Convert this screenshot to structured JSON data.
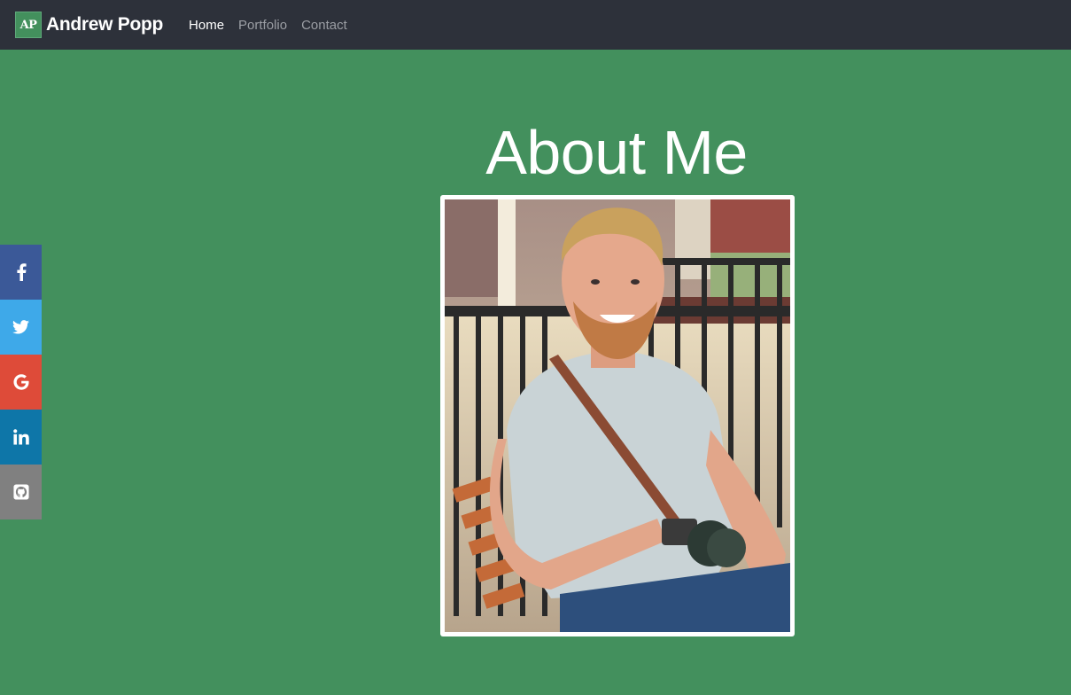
{
  "navbar": {
    "logo_text": "AP",
    "brand_name": "Andrew Popp",
    "links": [
      {
        "label": "Home",
        "active": true
      },
      {
        "label": "Portfolio",
        "active": false
      },
      {
        "label": "Contact",
        "active": false
      }
    ]
  },
  "social": [
    {
      "name": "facebook-icon",
      "color": "#3b5998"
    },
    {
      "name": "twitter-icon",
      "color": "#3ea9e9"
    },
    {
      "name": "google-icon",
      "color": "#de4b39"
    },
    {
      "name": "linkedin-icon",
      "color": "#0e76a8"
    },
    {
      "name": "github-icon",
      "color": "#808080"
    }
  ],
  "main": {
    "title": "About Me"
  },
  "colors": {
    "background": "#43905d",
    "navbar": "#2d313a"
  }
}
